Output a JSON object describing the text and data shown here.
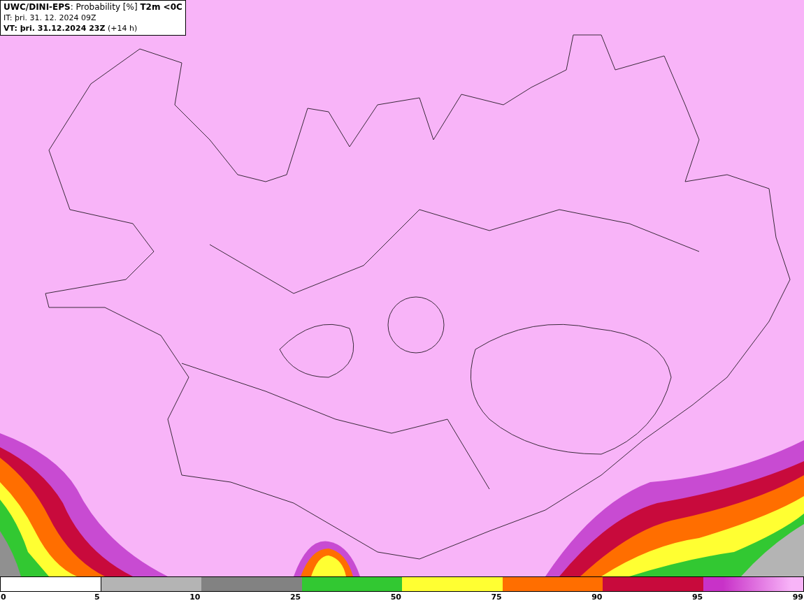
{
  "header": {
    "title": "**UWC/DINI-EPS**: Probability [%] **T2m <0C**",
    "issue_time": "IT: þri. 31. 12. 2024 09Z",
    "valid_time": "**VT: þri. 31.12.2024 23Z** (+14 h)"
  },
  "legend": {
    "segments": [
      {
        "color": "#ffffff"
      },
      {
        "color": "#b4b4b4"
      },
      {
        "color": "#828282"
      },
      {
        "color": "#32c832"
      },
      {
        "color": "#ffff32"
      },
      {
        "color": "#ff6e00"
      },
      {
        "color": "#c80a3c"
      },
      {
        "color": "#c832c8",
        "gradient_end": {
          "color": "#f8b4f8"
        }
      }
    ],
    "ticks": [
      "0",
      "5",
      "10",
      "25",
      "50",
      "75",
      "90",
      "95",
      "99"
    ]
  }
}
